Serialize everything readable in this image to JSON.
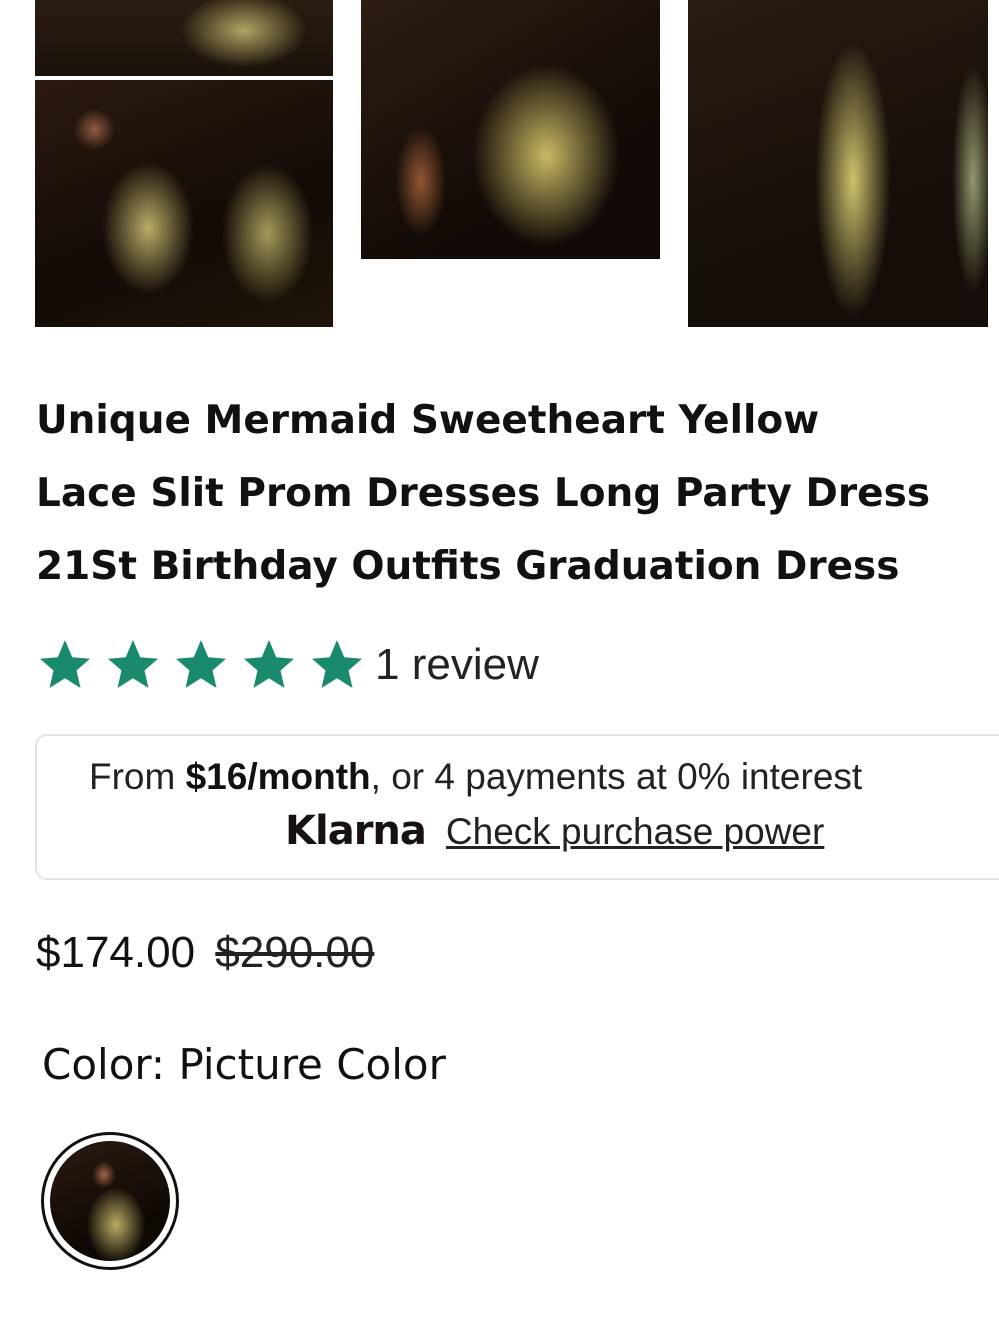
{
  "gallery": {
    "images": [
      {
        "alt": "Yellow lace dress photo"
      },
      {
        "alt": "Yellow lace dress photo"
      },
      {
        "alt": "Yellow lace dress photo"
      },
      {
        "alt": "Yellow lace dress photo"
      }
    ]
  },
  "product": {
    "title_lines": [
      "Unique Mermaid Sweetheart Yellow",
      "Lace Slit Prom Dresses Long Party Dress",
      "21St Birthday Outfits Graduation Dress"
    ],
    "rating": {
      "stars": 5,
      "max": 5,
      "review_count_text": "1 review",
      "star_color": "#1a8a6e"
    },
    "klarna": {
      "prefix": "From ",
      "amount": "$16/month",
      "suffix": ", or 4 payments at 0% interest",
      "logo": "Klarna",
      "link": "Check purchase power"
    },
    "price": {
      "current": "$174.00",
      "original": "$290.00"
    },
    "color": {
      "label": "Color:",
      "value": "Picture Color"
    }
  }
}
